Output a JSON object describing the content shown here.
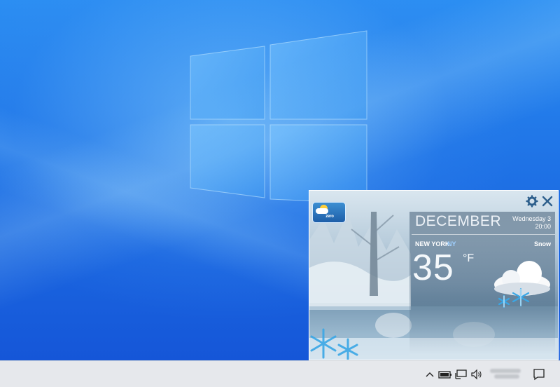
{
  "desktop": {
    "wallpaper": "windows-10-hero"
  },
  "widget": {
    "brand": "zero",
    "month": "DECEMBER",
    "day": "Wednesday 3",
    "time": "20:00",
    "city": "NEW YORK",
    "state": "NY",
    "condition": "Snow",
    "temperature": "35",
    "unit": "°F",
    "icons": {
      "settings": "gear-icon",
      "close": "close-icon",
      "weather": "cloud-snow-icon"
    }
  },
  "taskbar": {
    "tray_icons": [
      "chevron-up-icon",
      "battery-icon",
      "network-icon",
      "volume-icon"
    ],
    "notification_icon": "action-center-icon"
  },
  "colors": {
    "taskbar": "#e6e8ec",
    "accent": "#9fd0ff"
  }
}
